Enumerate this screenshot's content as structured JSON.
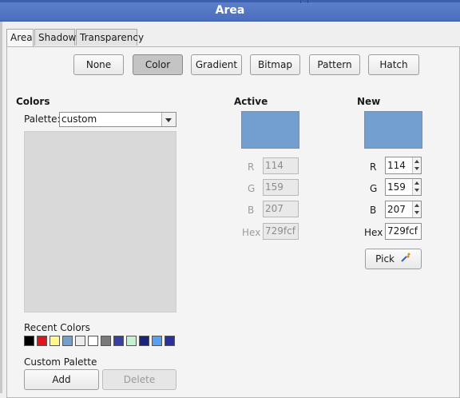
{
  "window": {
    "title": "Area"
  },
  "tabs": [
    {
      "label": "Area"
    },
    {
      "label": "Shadow"
    },
    {
      "label": "Transparency"
    }
  ],
  "fill_buttons": {
    "none": "None",
    "color": "Color",
    "gradient": "Gradient",
    "bitmap": "Bitmap",
    "pattern": "Pattern",
    "hatch": "Hatch"
  },
  "colors": {
    "heading": "Colors",
    "palette_label": "Palette:",
    "palette_value": "custom",
    "recent_label": "Recent Colors",
    "recent": [
      "#000000",
      "#e5121a",
      "#fff98a",
      "#729fcf",
      "#ececec",
      "#ffffff",
      "#7a7a7a",
      "#3a3fa3",
      "#c3f2cf",
      "#1a237e",
      "#5aa0f0",
      "#2b2fa0"
    ],
    "custom_palette_label": "Custom Palette",
    "add_label": "Add",
    "delete_label": "Delete"
  },
  "active": {
    "heading": "Active",
    "swatch_color": "#729fcf",
    "r_label": "R",
    "r": "114",
    "g_label": "G",
    "g": "159",
    "b_label": "B",
    "b": "207",
    "hex_label": "Hex",
    "hex": "729fcf"
  },
  "new": {
    "heading": "New",
    "swatch_color": "#729fcf",
    "r_label": "R",
    "r": "114",
    "g_label": "G",
    "g": "159",
    "b_label": "B",
    "b": "207",
    "hex_label": "Hex",
    "hex": "729fcf",
    "pick_label": "Pick"
  },
  "icons": {
    "pick": "eyedropper-icon",
    "dropdown": "chevron-down-icon"
  }
}
